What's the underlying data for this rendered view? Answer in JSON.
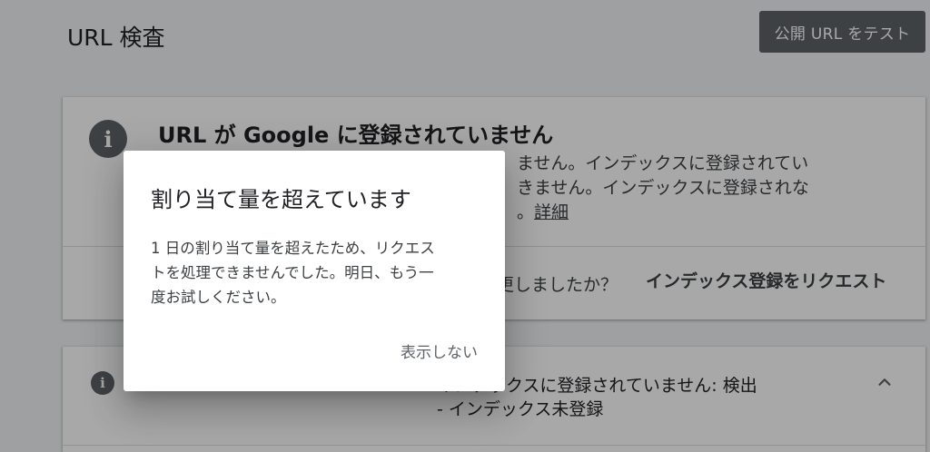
{
  "page": {
    "title": "URL 検査",
    "test_live_url_label": "公開 URL をテスト"
  },
  "status_card": {
    "title": "URL が Google に登録されていません",
    "desc_lines": [
      "ません。インデックスに登録されてい",
      "きません。インデックスに登録されな",
      "。"
    ],
    "detail_link": "詳細",
    "changed_prompt": "更しましたか？",
    "request_indexing_label": "インデックス登録をリクエスト"
  },
  "coverage_card": {
    "line1": "インデックスに登録されていません: 検出",
    "line2": "- インデックス未登録"
  },
  "dialog": {
    "title": "割り当て量を超えています",
    "body_lines": [
      "1 日の割り当て量を超えたため、リクエス",
      "トを処理できませんでした。明日、もう一",
      "度お試しください。"
    ],
    "dismiss_label": "表示しない"
  },
  "colors": {
    "primary_text": "#202124",
    "secondary_text": "#3c4043",
    "icon_gray": "#5f6368"
  }
}
